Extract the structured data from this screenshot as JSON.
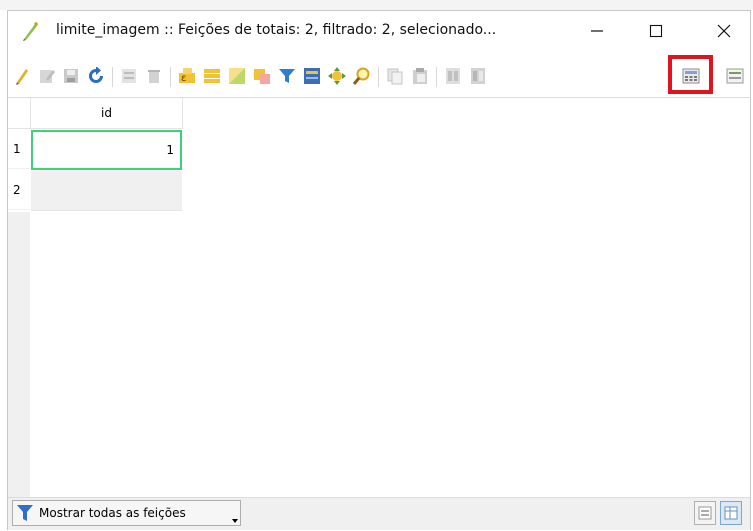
{
  "window": {
    "title": "limite_imagem :: Feições de totais: 2, filtrado: 2, selecionado...",
    "min_icon": "minimize-icon",
    "max_icon": "maximize-icon",
    "close_icon": "close-icon"
  },
  "toolbar": {
    "items": [
      "edit-pencil-icon",
      "toggle-multiedit-icon",
      "save-edits-icon",
      "reload-icon",
      "add-feature-icon",
      "delete-feature-icon",
      "expression-select-icon",
      "select-all-icon",
      "invert-selection-icon",
      "deselect-icon",
      "filter-select-icon",
      "move-selection-top-icon",
      "pan-to-selection-icon",
      "zoom-to-selection-icon",
      "copy-icon",
      "paste-icon",
      "delete-field-icon",
      "new-field-icon",
      "field-calculator-icon",
      "conditional-formatting-icon"
    ],
    "highlighted_item": "field-calculator-icon",
    "highlight_color": "#e0141e"
  },
  "table": {
    "columns": [
      "id"
    ],
    "rows": [
      {
        "row_label": "1",
        "id": "1"
      },
      {
        "row_label": "2",
        "id": ""
      }
    ],
    "selected_cell_color": "#3dd17a"
  },
  "bottom": {
    "filter_label": "Mostrar todas as feições",
    "filter_icon": "funnel-icon",
    "form_view_icon": "form-view-icon",
    "table_view_icon": "table-view-icon"
  }
}
